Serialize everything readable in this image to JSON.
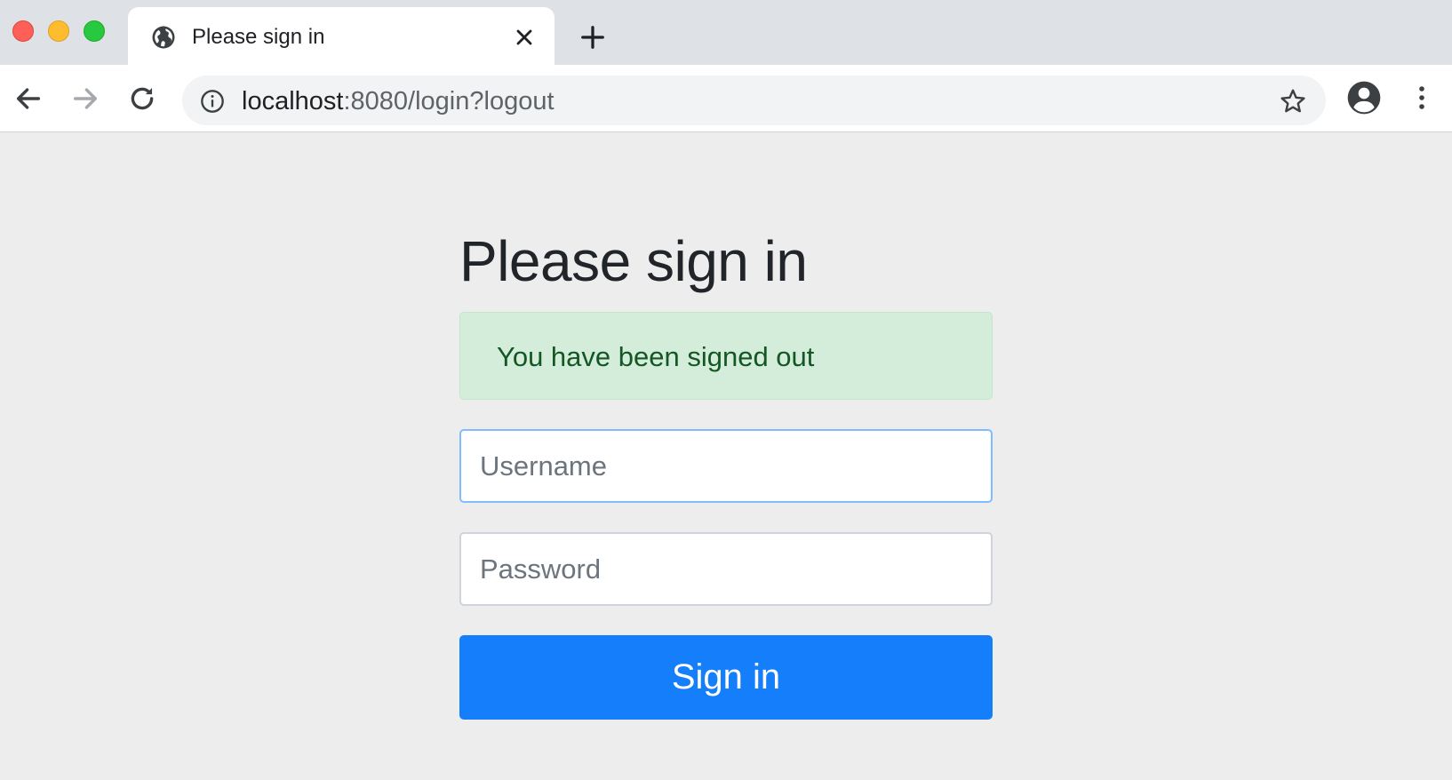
{
  "browser": {
    "tab": {
      "title": "Please sign in",
      "icon": "globe-icon"
    },
    "toolbar": {
      "url_host": "localhost",
      "url_path": ":8080/login?logout"
    },
    "colors": {
      "tab_strip": "#dee1e6",
      "traffic_red": "#fe5f57",
      "traffic_yellow": "#febc2e",
      "traffic_green": "#28c840"
    }
  },
  "page": {
    "title": "Please sign in",
    "alert": {
      "message": "You have been signed out",
      "color": "#155724",
      "background": "#d4edda"
    },
    "form": {
      "username_placeholder": "Username",
      "username_value": "",
      "password_placeholder": "Password",
      "password_value": "",
      "submit_label": "Sign in",
      "submit_color": "#147efb"
    }
  }
}
